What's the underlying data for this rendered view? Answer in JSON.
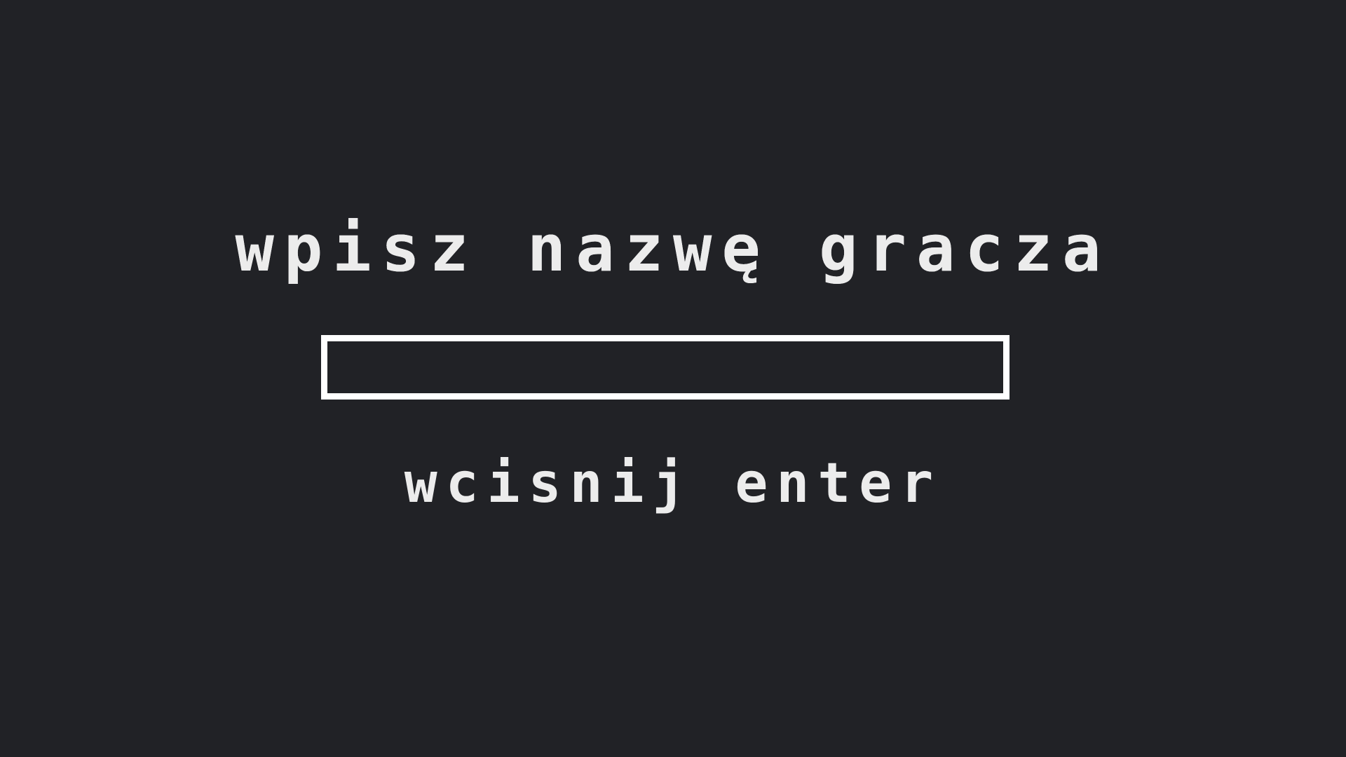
{
  "screen": {
    "title": "wpisz nazwę gracza",
    "input": {
      "value": "",
      "placeholder": ""
    },
    "hint": "wcisnij enter"
  },
  "colors": {
    "background": "#212226",
    "text": "#ececec",
    "input_border": "#ffffff"
  }
}
